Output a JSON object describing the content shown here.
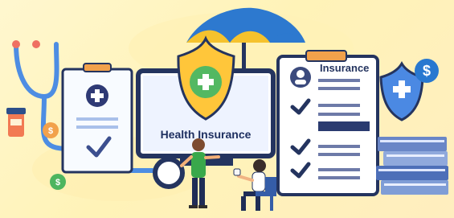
{
  "monitor": {
    "title": "Health Insurance"
  },
  "document": {
    "title": "Insurance"
  },
  "icons": {
    "dollar_symbol": "$",
    "list": [
      "stethoscope-icon",
      "umbrella-icon",
      "shield-plus-icon",
      "clipboard-icon",
      "monitor-icon",
      "document-icon",
      "dollar-coin-icon",
      "checkmark-icon",
      "avatar-icon",
      "books-icon",
      "person-icon",
      "chair-icon"
    ]
  },
  "colors": {
    "background": "#fff6c8",
    "navy": "#24345f",
    "blue": "#4b89e3",
    "yellow": "#ffc63a",
    "orange": "#f2a14b",
    "green": "#37b447",
    "light_blue": "#d9e6ff"
  }
}
